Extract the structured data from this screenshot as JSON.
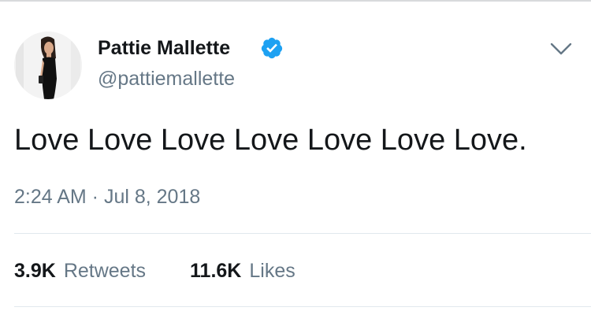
{
  "tweet": {
    "display_name": "Pattie Mallette",
    "handle": "@pattiemallette",
    "verified": true,
    "text": "Love Love Love Love Love Love Love.",
    "timestamp": "2:24 AM · Jul 8, 2018"
  },
  "stats": {
    "retweets_count": "3.9K",
    "retweets_label": "Retweets",
    "likes_count": "11.6K",
    "likes_label": "Likes"
  },
  "icons": {
    "verified": "verified-badge-icon",
    "menu": "chevron-down-icon"
  },
  "colors": {
    "text_primary": "#14171a",
    "text_secondary": "#657786",
    "verified_blue": "#1da1f2",
    "divider": "#e1e8ed"
  }
}
